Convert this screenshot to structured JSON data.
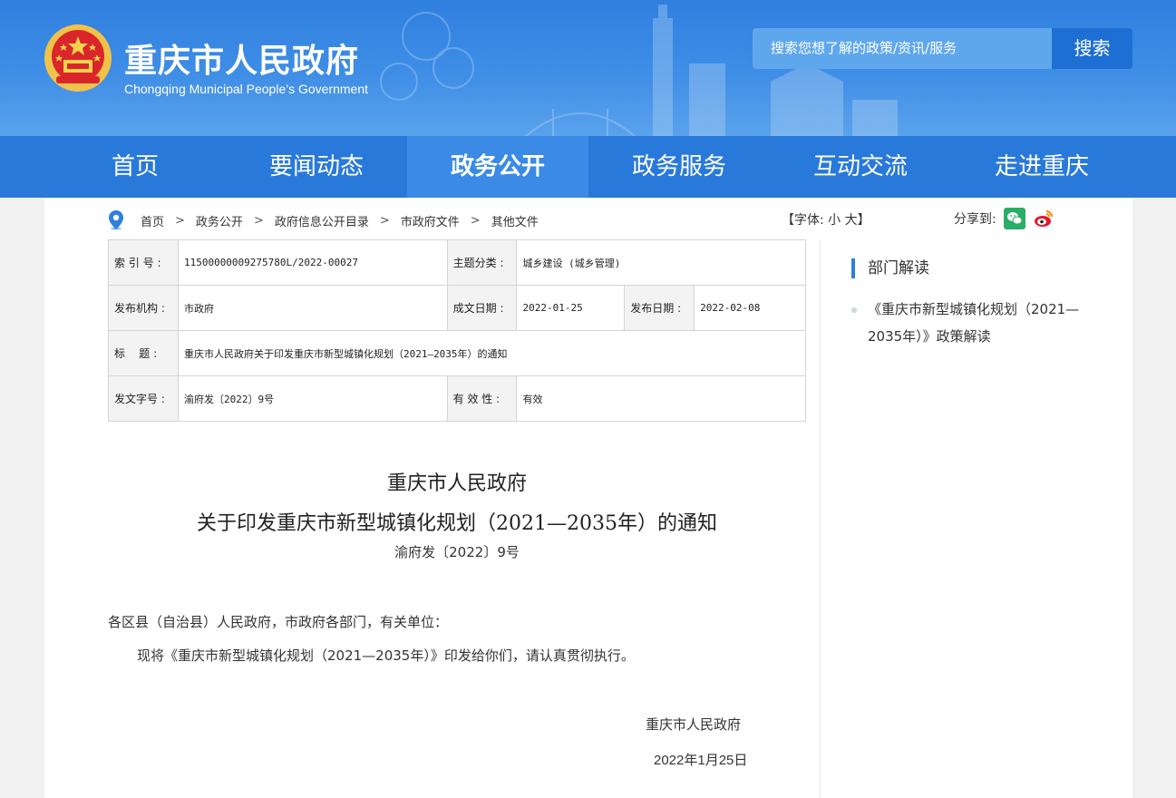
{
  "header": {
    "title": "重庆市人民政府",
    "subtitle": "Chongqing Municipal People’s Government",
    "search_placeholder": "搜索您想了解的政策/资讯/服务",
    "search_button": "搜索"
  },
  "nav": {
    "items": [
      {
        "label": "首页"
      },
      {
        "label": "要闻动态"
      },
      {
        "label": "政务公开"
      },
      {
        "label": "政务服务"
      },
      {
        "label": "互动交流"
      },
      {
        "label": "走进重庆"
      }
    ],
    "active_index": 2
  },
  "breadcrumb": {
    "items": [
      "首页",
      "政务公开",
      "政府信息公开目录",
      "市政府文件",
      "其他文件"
    ],
    "separator": ">"
  },
  "font_control": "【字体: 小 大】",
  "share_label": "分享到:",
  "meta": {
    "index_label": "索 引 号 :",
    "index_value": "11500000009275780L/2022-00027",
    "topic_label": "主题分类 :",
    "topic_value": "城乡建设 (城乡管理)",
    "publisher_label": "发布机构 :",
    "publisher_value": "市政府",
    "created_label": "成文日期 :",
    "created_value": "2022-01-25",
    "published_label": "发布日期 :",
    "published_value": "2022-02-08",
    "title_label": "标    题 :",
    "title_value": "重庆市人民政府关于印发重庆市新型城镇化规划（2021—2035年）的通知",
    "docno_label": "发文字号 :",
    "docno_value": "渝府发〔2022〕9号",
    "validity_label": "有 效 性 :",
    "validity_value": "有效"
  },
  "document": {
    "title_line1": "重庆市人民政府",
    "title_line2": "关于印发重庆市新型城镇化规划（2021—2035年）的通知",
    "doc_number": "渝府发〔2022〕9号",
    "salutation": "各区县（自治县）人民政府，市政府各部门，有关单位：",
    "body": "现将《重庆市新型城镇化规划（2021—2035年）》印发给你们，请认真贯彻执行。",
    "signature": "重庆市人民政府",
    "date": "2022年1月25日"
  },
  "sidebar": {
    "title": "部门解读",
    "links": [
      "《重庆市新型城镇化规划（2021—2035年）》政策解读"
    ]
  },
  "colors": {
    "header_blue": "#2f7fdf",
    "nav_blue": "#2979db",
    "nav_active": "#3b8ae6",
    "search_button": "#1d6fd3",
    "wechat_green": "#2aae67",
    "weibo_red": "#e6162d"
  }
}
